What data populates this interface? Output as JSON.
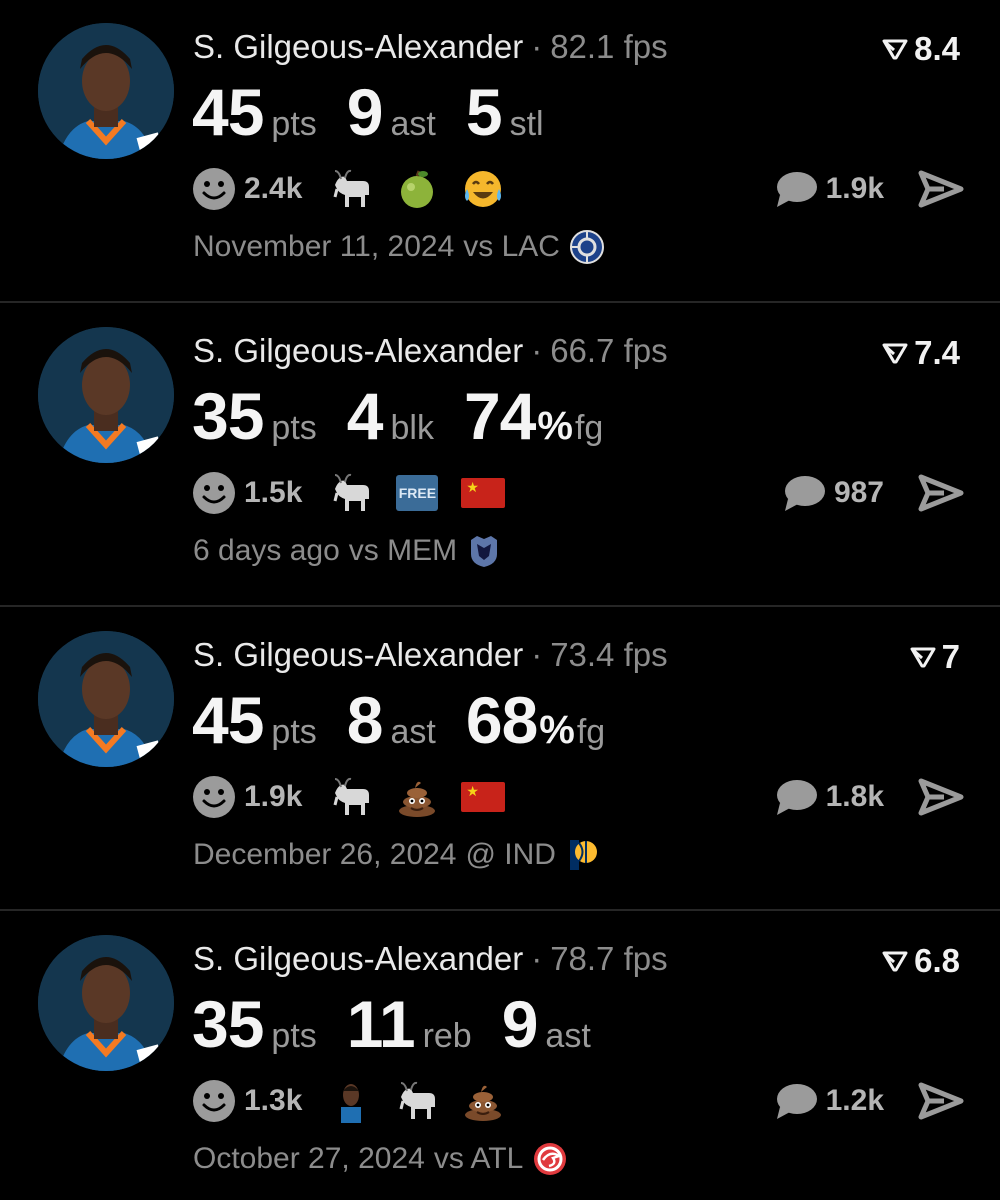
{
  "posts": [
    {
      "player": "S. Gilgeous-Alexander",
      "separator": "·",
      "fps": "82.1 fps",
      "rating": "8.4",
      "stats": [
        {
          "value": "45",
          "unit": "pts"
        },
        {
          "value": "9",
          "unit": "ast"
        },
        {
          "value": "5",
          "unit": "stl"
        }
      ],
      "reaction_count": "2.4k",
      "reactions": [
        "goat-emoji",
        "green-apple-emoji",
        "tears-of-joy-emoji"
      ],
      "comment_count": "1.9k",
      "date": "November 11, 2024",
      "opponent": "vs LAC",
      "team_logo": "clippers-logo"
    },
    {
      "player": "S. Gilgeous-Alexander",
      "separator": "·",
      "fps": "66.7 fps",
      "rating": "7.4",
      "stats": [
        {
          "value": "35",
          "unit": "pts"
        },
        {
          "value": "4",
          "unit": "blk"
        },
        {
          "value": "74",
          "pct": "%",
          "unit": "fg"
        }
      ],
      "reaction_count": "1.5k",
      "reactions": [
        "goat-emoji",
        "free-badge",
        "china-flag"
      ],
      "free_label": "FREE",
      "comment_count": "987",
      "date": "6 days ago",
      "opponent": "vs MEM",
      "team_logo": "grizzlies-logo"
    },
    {
      "player": "S. Gilgeous-Alexander",
      "separator": "·",
      "fps": "73.4 fps",
      "rating": "7",
      "stats": [
        {
          "value": "45",
          "unit": "pts"
        },
        {
          "value": "8",
          "unit": "ast"
        },
        {
          "value": "68",
          "pct": "%",
          "unit": "fg"
        }
      ],
      "reaction_count": "1.9k",
      "reactions": [
        "goat-emoji",
        "poop-emoji",
        "china-flag"
      ],
      "comment_count": "1.8k",
      "date": "December 26, 2024",
      "opponent": "@ IND",
      "team_logo": "pacers-logo"
    },
    {
      "player": "S. Gilgeous-Alexander",
      "separator": "·",
      "fps": "78.7 fps",
      "rating": "6.8",
      "stats": [
        {
          "value": "35",
          "unit": "pts"
        },
        {
          "value": "11",
          "unit": "reb"
        },
        {
          "value": "9",
          "unit": "ast"
        }
      ],
      "reaction_count": "1.3k",
      "reactions": [
        "player-sticker",
        "goat-emoji",
        "poop-emoji"
      ],
      "comment_count": "1.2k",
      "date": "October 27, 2024",
      "opponent": "vs ATL",
      "team_logo": "hawks-logo"
    }
  ],
  "colors": {
    "background": "#000000",
    "text_primary": "#f2f2f2",
    "text_secondary": "#8c8c8c",
    "icon_gray": "#9b9b9b",
    "avatar_bg": "#14364e",
    "divider": "#262626"
  }
}
